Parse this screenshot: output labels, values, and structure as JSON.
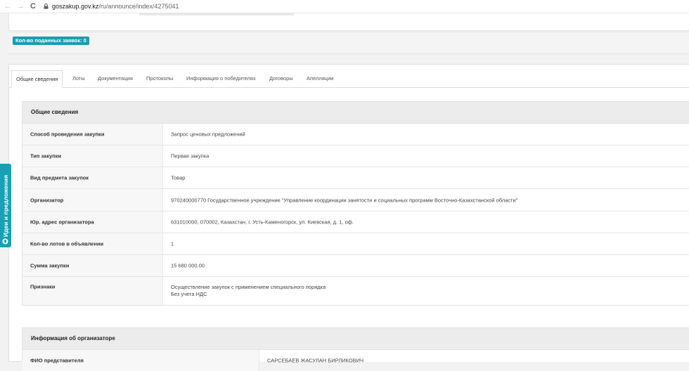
{
  "browser": {
    "host": "goszakup.gov.kz",
    "path": "/ru/announce/index/4275041",
    "back": "←",
    "forward": "→",
    "reload": "C"
  },
  "bids_badge": "Кол-во поданных заявок: 0",
  "tabs": [
    "Общие сведения",
    "Лоты",
    "Документация",
    "Протоколы",
    "Информация о победителях",
    "Договоры",
    "Апелляции"
  ],
  "general": {
    "title": "Общие сведения",
    "rows": [
      {
        "label": "Способ проведения закупки",
        "value": "Запрос ценовых предложений"
      },
      {
        "label": "Тип закупки",
        "value": "Первая закупка"
      },
      {
        "label": "Вид предмета закупок",
        "value": "Товар"
      },
      {
        "label": "Организатор",
        "value": "970240000770 Государственное учреждение \"Управление координации занятости и социальных программ Восточно-Казахстанской области\""
      },
      {
        "label": "Юр. адрес организатора",
        "value": "631010000, 070002, Казахстан, г. Усть-Каменогорск, ул. Киевская, д. 1, оф."
      },
      {
        "label": "Кол-во лотов в объявлении",
        "value": "1"
      },
      {
        "label": "Сумма закупки",
        "value": "15 680 000.00"
      },
      {
        "label": "Признаки",
        "value_lines": [
          "Осуществление закупок с применением специального порядка",
          "Без учета НДС"
        ]
      }
    ]
  },
  "organizer": {
    "title": "Информация об организаторе",
    "rows": [
      {
        "label": "ФИО представителя",
        "value": "САРСЕБАЕВ ЖАСУЛАН БИРЛИКОВИЧ"
      }
    ]
  },
  "side_tab": {
    "label": "Идеи и предложения",
    "icon": "lightbulb-icon"
  },
  "colors": {
    "accent": "#19a0b4",
    "header_bg": "#ececec",
    "label_bg": "#f7f7f7"
  }
}
